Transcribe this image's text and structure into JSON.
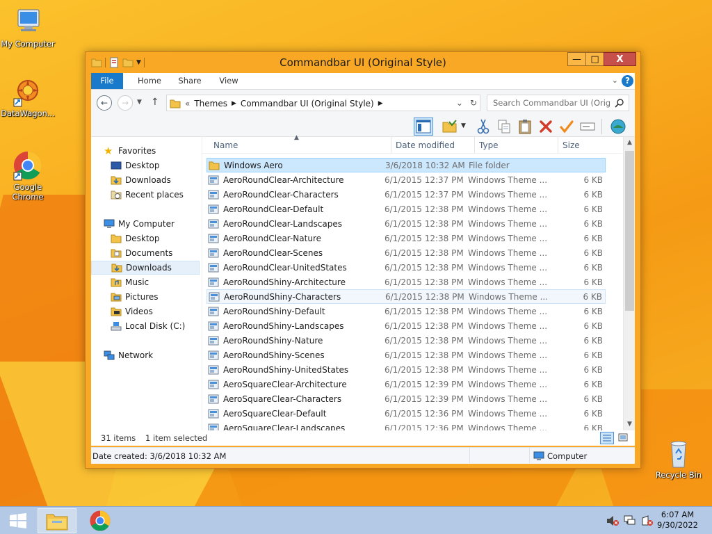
{
  "desktop": {
    "icons": [
      {
        "label": "My Computer"
      },
      {
        "label": "DataWagon..."
      },
      {
        "label": "Google Chrome"
      },
      {
        "label": "Recycle Bin"
      }
    ]
  },
  "window": {
    "title": "Commandbar UI (Original Style)",
    "controls": {
      "minimize": "—",
      "maximize": "□",
      "close": "X"
    }
  },
  "ribbon": {
    "tabs": [
      "File",
      "Home",
      "Share",
      "View"
    ],
    "help": "?"
  },
  "address": {
    "prefix": "«",
    "crumbs": [
      "Themes",
      "Commandbar UI (Original Style)"
    ]
  },
  "search": {
    "placeholder": "Search Commandbar UI (Orig..."
  },
  "navigation": {
    "favorites_label": "Favorites",
    "favorites": [
      "Desktop",
      "Downloads",
      "Recent places"
    ],
    "computer_label": "My Computer",
    "computer": [
      "Desktop",
      "Documents",
      "Downloads",
      "Music",
      "Pictures",
      "Videos",
      "Local Disk (C:)"
    ],
    "network_label": "Network",
    "selected": "Downloads"
  },
  "columns": {
    "name": "Name",
    "date": "Date modified",
    "type": "Type",
    "size": "Size"
  },
  "files": [
    {
      "name": "Windows Aero",
      "date": "3/6/2018 10:32 AM",
      "type": "File folder",
      "size": "",
      "kind": "folder"
    },
    {
      "name": "AeroRoundClear-Architecture",
      "date": "6/1/2015 12:37 PM",
      "type": "Windows Theme ...",
      "size": "6 KB",
      "kind": "theme"
    },
    {
      "name": "AeroRoundClear-Characters",
      "date": "6/1/2015 12:37 PM",
      "type": "Windows Theme ...",
      "size": "6 KB",
      "kind": "theme"
    },
    {
      "name": "AeroRoundClear-Default",
      "date": "6/1/2015 12:38 PM",
      "type": "Windows Theme ...",
      "size": "6 KB",
      "kind": "theme"
    },
    {
      "name": "AeroRoundClear-Landscapes",
      "date": "6/1/2015 12:38 PM",
      "type": "Windows Theme ...",
      "size": "6 KB",
      "kind": "theme"
    },
    {
      "name": "AeroRoundClear-Nature",
      "date": "6/1/2015 12:38 PM",
      "type": "Windows Theme ...",
      "size": "6 KB",
      "kind": "theme"
    },
    {
      "name": "AeroRoundClear-Scenes",
      "date": "6/1/2015 12:38 PM",
      "type": "Windows Theme ...",
      "size": "6 KB",
      "kind": "theme"
    },
    {
      "name": "AeroRoundClear-UnitedStates",
      "date": "6/1/2015 12:38 PM",
      "type": "Windows Theme ...",
      "size": "6 KB",
      "kind": "theme"
    },
    {
      "name": "AeroRoundShiny-Architecture",
      "date": "6/1/2015 12:38 PM",
      "type": "Windows Theme ...",
      "size": "6 KB",
      "kind": "theme"
    },
    {
      "name": "AeroRoundShiny-Characters",
      "date": "6/1/2015 12:38 PM",
      "type": "Windows Theme ...",
      "size": "6 KB",
      "kind": "theme"
    },
    {
      "name": "AeroRoundShiny-Default",
      "date": "6/1/2015 12:38 PM",
      "type": "Windows Theme ...",
      "size": "6 KB",
      "kind": "theme"
    },
    {
      "name": "AeroRoundShiny-Landscapes",
      "date": "6/1/2015 12:38 PM",
      "type": "Windows Theme ...",
      "size": "6 KB",
      "kind": "theme"
    },
    {
      "name": "AeroRoundShiny-Nature",
      "date": "6/1/2015 12:38 PM",
      "type": "Windows Theme ...",
      "size": "6 KB",
      "kind": "theme"
    },
    {
      "name": "AeroRoundShiny-Scenes",
      "date": "6/1/2015 12:38 PM",
      "type": "Windows Theme ...",
      "size": "6 KB",
      "kind": "theme"
    },
    {
      "name": "AeroRoundShiny-UnitedStates",
      "date": "6/1/2015 12:38 PM",
      "type": "Windows Theme ...",
      "size": "6 KB",
      "kind": "theme"
    },
    {
      "name": "AeroSquareClear-Architecture",
      "date": "6/1/2015 12:39 PM",
      "type": "Windows Theme ...",
      "size": "6 KB",
      "kind": "theme"
    },
    {
      "name": "AeroSquareClear-Characters",
      "date": "6/1/2015 12:39 PM",
      "type": "Windows Theme ...",
      "size": "6 KB",
      "kind": "theme"
    },
    {
      "name": "AeroSquareClear-Default",
      "date": "6/1/2015 12:36 PM",
      "type": "Windows Theme ...",
      "size": "6 KB",
      "kind": "theme"
    },
    {
      "name": "AeroSquareClear-Landscapes",
      "date": "6/1/2015 12:36 PM",
      "type": "Windows Theme ...",
      "size": "6 KB",
      "kind": "theme"
    }
  ],
  "selected_row": 0,
  "hover_row": 9,
  "status": {
    "count": "31 items",
    "selection": "1 item selected"
  },
  "details": {
    "created": "Date created: 3/6/2018 10:32 AM",
    "location": "Computer"
  },
  "taskbar": {
    "time": "6:07 AM",
    "date": "9/30/2022"
  },
  "colors": {
    "accent": "#1979ca",
    "window_frame": "#f9a826",
    "selection": "#cce8ff",
    "close": "#c7504a",
    "taskbar": "#b4c9e5"
  },
  "icons": {
    "nav_back": "arrow-left-icon",
    "nav_forward": "arrow-right-icon",
    "up": "arrow-up-icon",
    "refresh": "refresh-icon",
    "search": "search-icon",
    "commands": [
      "layout-icon",
      "folder-options-icon",
      "cut-icon",
      "copy-icon",
      "paste-icon",
      "delete-icon",
      "properties-icon",
      "rename-icon",
      "globe-icon"
    ]
  }
}
